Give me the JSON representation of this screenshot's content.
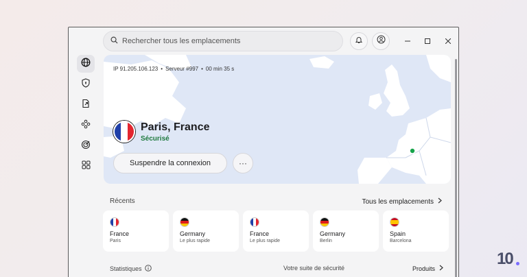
{
  "search": {
    "placeholder": "Rechercher tous les emplacements"
  },
  "connection": {
    "ip": "IP 91.205.106.123",
    "server": "Serveur #997",
    "duration": "00 min 35 s",
    "separator": "•",
    "location": "Paris, France",
    "status": "Sécurisé",
    "pause_label": "Suspendre la connexion",
    "more_label": "···"
  },
  "recents": {
    "title": "Récents",
    "all_label": "Tous les emplacements",
    "items": [
      {
        "country": "France",
        "sub": "Paris",
        "flag": "fr"
      },
      {
        "country": "Germany",
        "sub": "Le plus rapide",
        "flag": "de"
      },
      {
        "country": "France",
        "sub": "Le plus rapide",
        "flag": "fr"
      },
      {
        "country": "Germany",
        "sub": "Berlin",
        "flag": "de"
      },
      {
        "country": "Spain",
        "sub": "Barcelona",
        "flag": "es"
      }
    ]
  },
  "bottom": {
    "stats_label": "Statistiques",
    "suite_label": "Votre suite de sécurité",
    "products_label": "Produits"
  },
  "brand": {
    "logo_text": "10",
    "accent": "#1f7a3f",
    "logo_dot": "#7a6cff"
  },
  "icons": {
    "sidebar": [
      "globe-icon",
      "shield-icon",
      "file-share-icon",
      "mesh-icon",
      "radar-icon",
      "apps-grid-icon"
    ]
  }
}
